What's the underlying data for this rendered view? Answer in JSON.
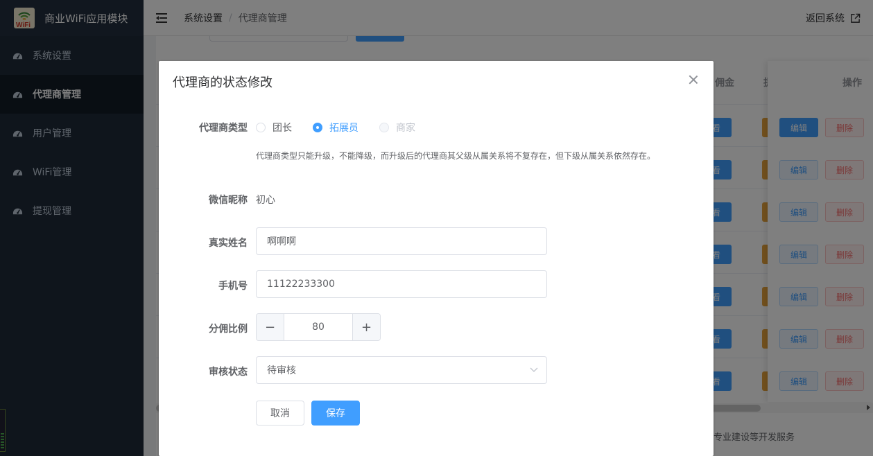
{
  "app": {
    "title": "商业WiFi应用模块",
    "logo_text": "WiFi"
  },
  "sidebar": {
    "items": [
      {
        "label": "系统设置",
        "active": false
      },
      {
        "label": "代理商管理",
        "active": true
      },
      {
        "label": "用户管理",
        "active": false
      },
      {
        "label": "WiFi管理",
        "active": false
      },
      {
        "label": "提现管理",
        "active": false
      }
    ]
  },
  "header": {
    "breadcrumb": [
      "系统设置",
      "代理商管理"
    ],
    "breadcrumb_sep": "/",
    "back_label": "返回系统"
  },
  "table": {
    "columns_visible": [
      "佣金",
      "提",
      "操作"
    ],
    "view_label": "看",
    "edit_label": "编辑",
    "delete_label": "删除",
    "rows": 7
  },
  "footer_text": "专业建设等开发服务",
  "dialog": {
    "title": "代理商的状态修改",
    "type_label": "代理商类型",
    "type_options": [
      {
        "label": "团长",
        "state": "normal"
      },
      {
        "label": "拓展员",
        "state": "checked"
      },
      {
        "label": "商家",
        "state": "disabled"
      }
    ],
    "type_hint": "代理商类型只能升级，不能降级，而升级后的代理商其父级从属关系将不复存在，但下级从属关系依然存在。",
    "nickname_label": "微信昵称",
    "nickname_value": "初心",
    "realname_label": "真实姓名",
    "realname_value": "啊啊啊",
    "phone_label": "手机号",
    "phone_value": "11122233300",
    "ratio_label": "分佣比例",
    "ratio_value": "80",
    "ratio_minus": "−",
    "ratio_plus": "+",
    "status_label": "审核状态",
    "status_value": "待审核",
    "cancel_label": "取消",
    "save_label": "保存"
  },
  "colors": {
    "primary": "#409eff",
    "danger": "#f56c6c",
    "warning": "#e6a23c",
    "sidebar_bg": "#1e2a38"
  }
}
